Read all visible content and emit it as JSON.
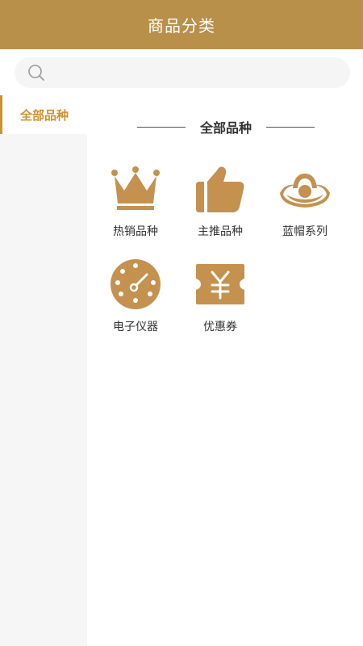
{
  "header": {
    "title": "商品分类"
  },
  "search": {
    "placeholder": "",
    "value": ""
  },
  "sidebar": {
    "items": [
      {
        "label": "全部品种",
        "active": true
      }
    ]
  },
  "section": {
    "title": "全部品种"
  },
  "categories": [
    {
      "label": "热销品种",
      "icon": "crown-icon"
    },
    {
      "label": "主推品种",
      "icon": "thumbs-up-icon"
    },
    {
      "label": "蓝帽系列",
      "icon": "blue-hat-icon"
    },
    {
      "label": "电子仪器",
      "icon": "gauge-icon"
    },
    {
      "label": "优惠券",
      "icon": "coupon-icon"
    }
  ],
  "colors": {
    "brand": "#b8904a",
    "accent": "#d3912c",
    "icon": "#c4914f"
  }
}
